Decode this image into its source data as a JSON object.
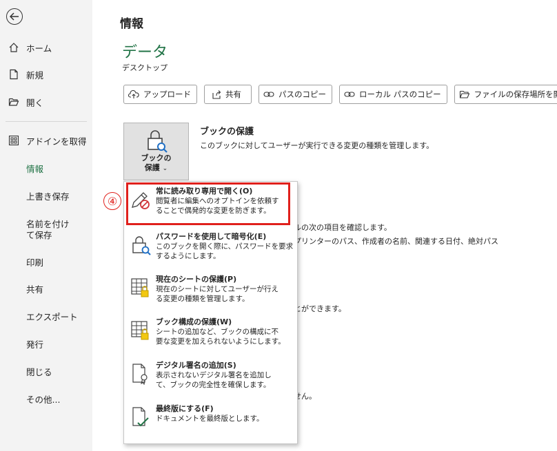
{
  "sidebar": {
    "back_label": "",
    "items": [
      {
        "label": "ホーム",
        "icon": "home-icon"
      },
      {
        "label": "新規",
        "icon": "new-document-icon"
      },
      {
        "label": "開く",
        "icon": "open-folder-icon"
      },
      {
        "label": "アドインを取得",
        "icon": "addins-grid-icon"
      },
      {
        "label": "情報"
      },
      {
        "label": "上書き保存"
      },
      {
        "label": "名前を付けて保存"
      },
      {
        "label": "印刷"
      },
      {
        "label": "共有"
      },
      {
        "label": "エクスポート"
      },
      {
        "label": "発行"
      },
      {
        "label": "閉じる"
      },
      {
        "label": "その他..."
      }
    ]
  },
  "main": {
    "page_title": "情報",
    "file_title": "データ",
    "file_location": "デスクトップ",
    "toolbar": {
      "upload": "アップロード",
      "share": "共有",
      "copy_path": "パスのコピー",
      "copy_local_path": "ローカル パスのコピー",
      "open_location": "ファイルの保存場所を開く"
    },
    "protect": {
      "button_label_1": "ブックの",
      "button_label_2": "保護",
      "chevron": "⌄",
      "title": "ブックの保護",
      "description": "このブックに対してユーザーが実行できる変更の種類を管理します。"
    },
    "background_text": {
      "line1": "ルの次の項目を確認します。",
      "line2": "プリンターのパス、作成者の名前、関連する日付、絶対パス",
      "line3": "とができます。",
      "line4": "せん。"
    }
  },
  "dropdown": {
    "items": [
      {
        "title": "常に読み取り専用で開く(O)",
        "desc1": "閲覧者に編集へのオプトインを依頼す",
        "desc2": "ることで偶発的な変更を防ぎます。"
      },
      {
        "title": "パスワードを使用して暗号化(E)",
        "desc1": "このブックを開く際に、パスワードを要求",
        "desc2": "するようにします。"
      },
      {
        "title": "現在のシートの保護(P)",
        "desc1": "現在のシートに対してユーザーが行え",
        "desc2": "る変更の種類を管理します。"
      },
      {
        "title": "ブック構成の保護(W)",
        "desc1": "シートの追加など、ブックの構成に不",
        "desc2": "要な変更を加えられないようにします。"
      },
      {
        "title": "デジタル署名の追加(S)",
        "desc1": "表示されないデジタル署名を追加し",
        "desc2": "て、ブックの完全性を確保します。"
      },
      {
        "title": "最終版にする(F)",
        "desc1": "ドキュメントを最終版とします。",
        "desc2": ""
      }
    ]
  },
  "annotation": {
    "step_number": "④",
    "highlight_color": "#e0201c"
  },
  "colors": {
    "accent": "#217346",
    "sidebar_bg": "#f3f3f3",
    "main_bg": "#ffffff"
  }
}
